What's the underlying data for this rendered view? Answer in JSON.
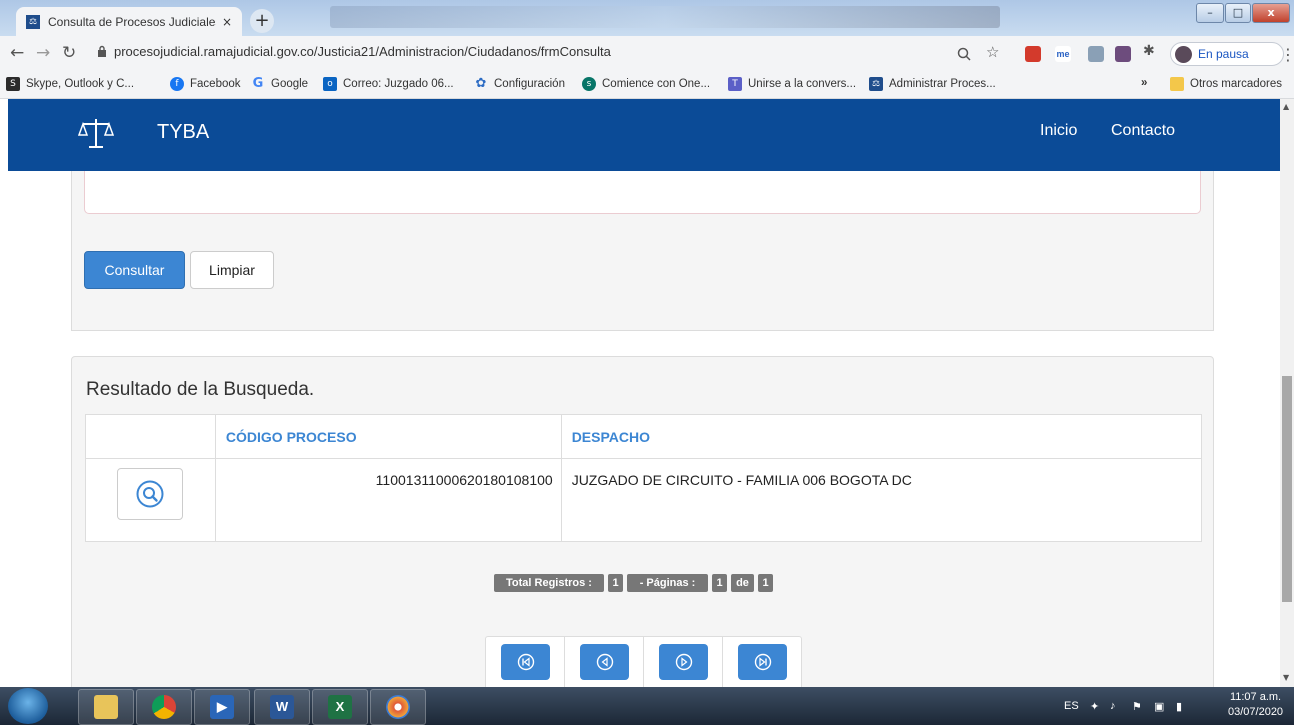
{
  "browser": {
    "tab_title": "Consulta de Procesos Judiciales -",
    "tab_close": "×",
    "new_tab": "+",
    "url": "procesojudicial.ramajudicial.gov.co/Justicia21/Administracion/Ciudadanos/frmConsulta",
    "profile_label": "En pausa",
    "window_controls": {
      "minimize": "–",
      "maximize": "□",
      "close": "x"
    }
  },
  "bookmarks": {
    "items": [
      {
        "label": "Skype, Outlook y C...",
        "icon": "skype-icon",
        "color": "#2b2b2b"
      },
      {
        "label": "Facebook",
        "icon": "facebook-icon",
        "color": "#1877f2"
      },
      {
        "label": "Google",
        "icon": "google-icon",
        "color": "#4285f4"
      },
      {
        "label": "Correo: Juzgado 06...",
        "icon": "outlook-icon",
        "color": "#0a64c2"
      },
      {
        "label": "Configuración",
        "icon": "gear-icon",
        "color": "#2d6cc4"
      },
      {
        "label": "Comience con One...",
        "icon": "sharepoint-icon",
        "color": "#077568"
      },
      {
        "label": "Unirse a la convers...",
        "icon": "teams-icon",
        "color": "#5b5fc7"
      },
      {
        "label": "Administrar Proces...",
        "icon": "rama-icon",
        "color": "#1f4d8c"
      }
    ],
    "more": "»",
    "other_folder": "Otros marcadores"
  },
  "site": {
    "brand": "TYBA",
    "nav": [
      "Inicio",
      "Contacto"
    ]
  },
  "form": {
    "consultar_label": "Consultar",
    "limpiar_label": "Limpiar"
  },
  "results": {
    "title": "Resultado de la Busqueda.",
    "columns": [
      "",
      "CÓDIGO PROCESO",
      "DESPACHO"
    ],
    "rows": [
      {
        "codigo": "11001311000620180108100",
        "despacho": "JUZGADO DE CIRCUITO - FAMILIA 006 BOGOTA DC"
      }
    ]
  },
  "pagination": {
    "total_label": "Total Registros :",
    "total_value": "1",
    "pages_label": "- Páginas :",
    "page_value": "1",
    "of_label": "de",
    "page_count": "1"
  },
  "taskbar": {
    "lang": "ES",
    "time": "11:07 a.m.",
    "date": "03/07/2020",
    "apps": [
      "explorer-icon",
      "chrome-icon",
      "media-icon",
      "word-icon",
      "excel-icon",
      "paint-icon"
    ]
  },
  "colors": {
    "navbar": "#0b4b97",
    "primary": "#3c86d3",
    "link": "#3c86d3"
  }
}
